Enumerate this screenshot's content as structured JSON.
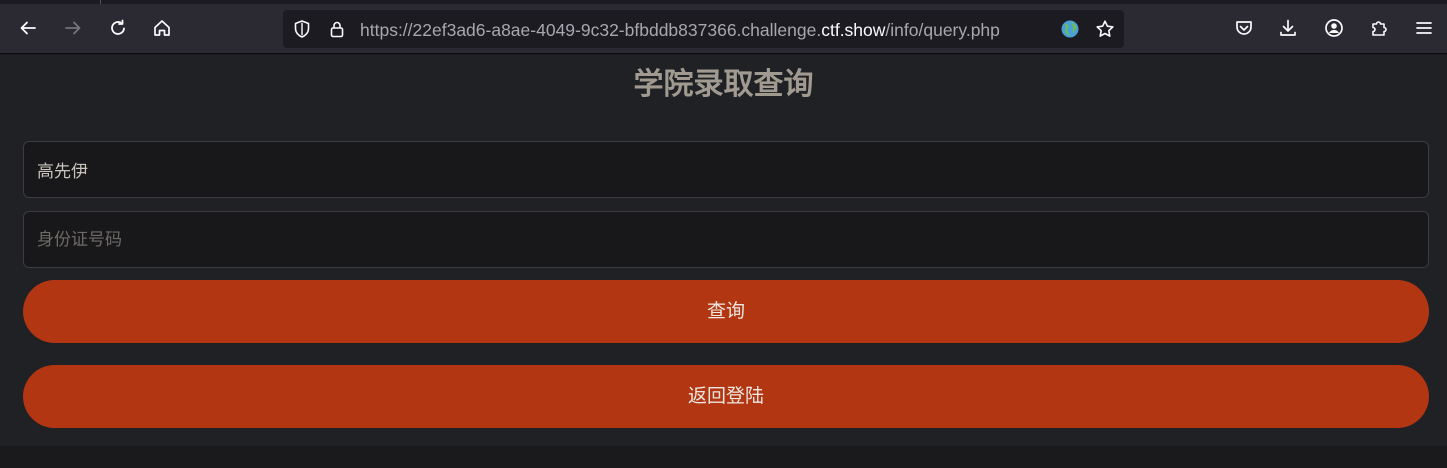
{
  "browser": {
    "url_prefix": "https://22ef3ad6-a8ae-4049-9c32-bfbddb837366.challenge.",
    "url_domain": "ctf.show",
    "url_path": "/info/query.php"
  },
  "page": {
    "title": "学院录取查询",
    "name_field": {
      "value": "高先伊",
      "placeholder": ""
    },
    "id_field": {
      "value": "",
      "placeholder": "身份证号码"
    },
    "query_button": "查询",
    "back_button": "返回登陆"
  },
  "colors": {
    "accent": "#b13611",
    "page_bg": "#202124",
    "toolbar_bg": "#2b2a33"
  }
}
